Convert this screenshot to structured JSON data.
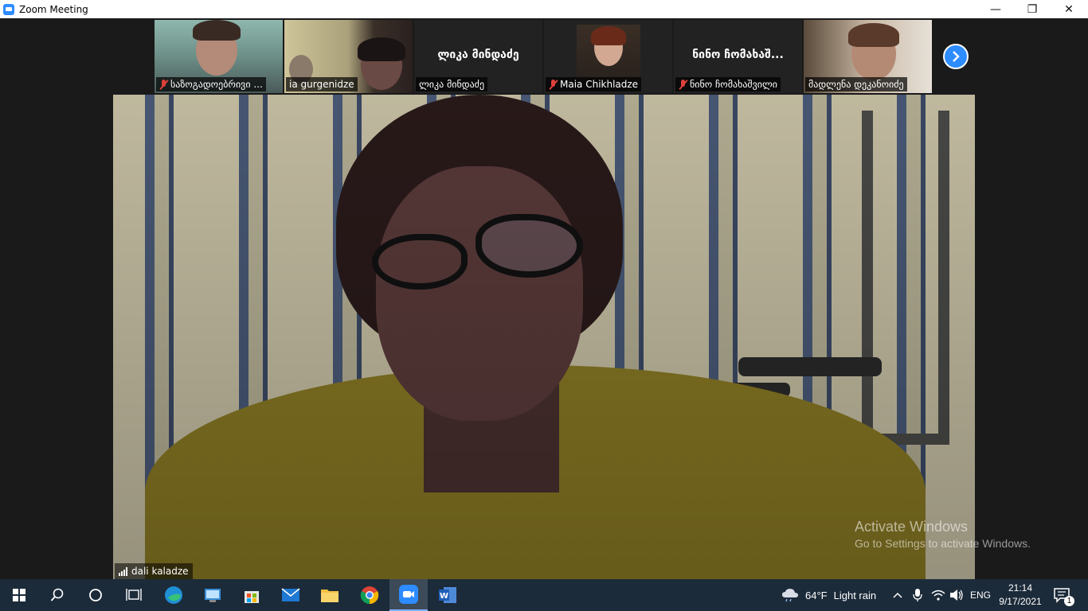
{
  "window": {
    "title": "Zoom Meeting",
    "minimize_glyph": "—",
    "restore_glyph": "❐",
    "close_glyph": "✕"
  },
  "participants": [
    {
      "name": "საზოგადოებრივი ...",
      "muted": true,
      "video": "on"
    },
    {
      "name": "ia gurgenidze",
      "muted": false,
      "video": "on"
    },
    {
      "name": "ლიკა მინდაძე",
      "display_name": "ლიკა მინდაძე",
      "muted": false,
      "video": "off"
    },
    {
      "name": "Maia Chikhladze",
      "muted": true,
      "video": "photo"
    },
    {
      "name": "ნინო ჩომახაშვილი",
      "display_name": "ნინო ჩომახაშ...",
      "muted": true,
      "video": "off"
    },
    {
      "name": "მადლენა დეკანოიძე",
      "muted": false,
      "video": "on"
    }
  ],
  "main_speaker": {
    "name": "dali kaladze",
    "signal_icon": "signal-bars-icon"
  },
  "next_page_icon": "chevron-right-icon",
  "watermark": {
    "line1": "Activate Windows",
    "line2": "Go to Settings to activate Windows."
  },
  "taskbar": {
    "weather_temp": "64°F",
    "weather_desc": "Light rain",
    "language": "ENG",
    "time": "21:14",
    "date": "9/17/2021",
    "notification_count": "1"
  },
  "colors": {
    "zoom_blue": "#2d8cff",
    "muted_red": "#e0403a",
    "taskbar_bg": "#1c2b3a"
  }
}
